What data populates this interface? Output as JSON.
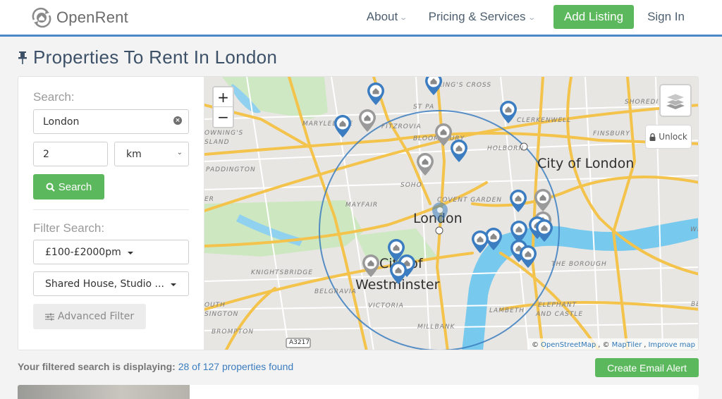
{
  "header": {
    "brand": "OpenRent",
    "nav": [
      {
        "label": "About",
        "has_dropdown": true
      },
      {
        "label": "Pricing & Services",
        "has_dropdown": true
      }
    ],
    "add_listing_label": "Add Listing",
    "sign_in_label": "Sign In",
    "accent_color": "#4a88c7",
    "button_color": "#5cb85c"
  },
  "page": {
    "title": "Properties To Rent In London",
    "title_icon": "pin-icon"
  },
  "sidebar": {
    "search_label": "Search:",
    "location_value": "London",
    "radius_value": "2",
    "unit_value": "km",
    "search_button_label": "Search",
    "filter_label": "Filter Search:",
    "price_filter": "£100-£2000pm",
    "type_filter": "Shared House, Studio ...",
    "advanced_filter_label": "Advanced Filter"
  },
  "map": {
    "zoom_in": "+",
    "zoom_out": "−",
    "unlock_label": "Unlock",
    "attribution": {
      "prefix": "©",
      "osm": "OpenStreetMap",
      "sep": ", ©",
      "maptiler": "MapTiler",
      "improve": "Improve map"
    },
    "area_labels": [
      "KING'S CROSS",
      "SHOREDITCH",
      "CLERKENWELL",
      "FINSBURY",
      "MARYLEBONE",
      "FITZROVIA",
      "BLOOMSBURY",
      "HOLBORN",
      "PADDINGTON",
      "SOHO",
      "COVENT GARDEN",
      "MAYFAIR",
      "KNIGHTSBRIDGE",
      "BELGRAVIA",
      "VICTORIA",
      "LAMBETH",
      "MILLBANK",
      "THE BOROUGH",
      "ELEPHANT",
      "AND CASTLE",
      "BROMPTON",
      "OUTH",
      "SINGTON",
      "OWNING'S",
      "SLAND",
      "ER",
      "WH",
      "BERI",
      "ST PA"
    ],
    "city_labels": [
      "City of London",
      "London",
      "City of",
      "Westminster"
    ],
    "road_badge": "A3217"
  },
  "results": {
    "prefix": "Your filtered search is displaying:",
    "count_text": "28 of 127 properties found",
    "shown": 28,
    "total": 127,
    "alert_button_label": "Create Email Alert"
  }
}
